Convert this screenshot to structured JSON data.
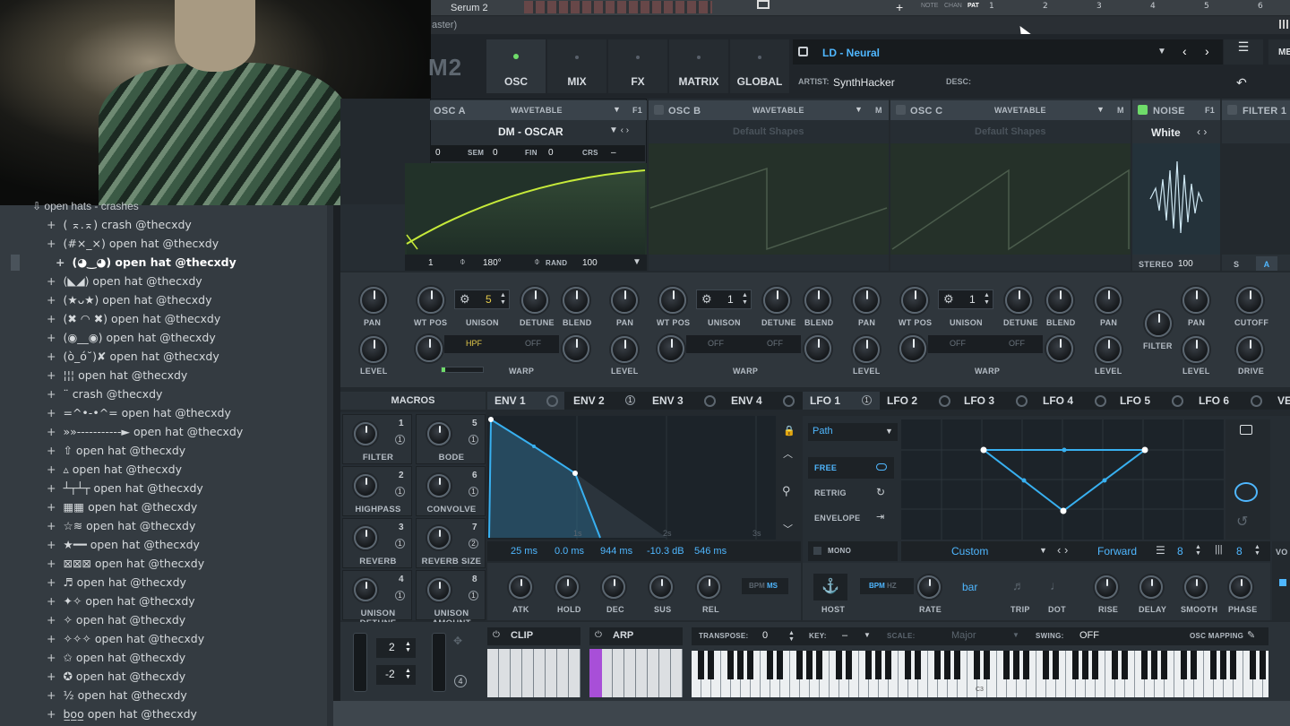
{
  "host_bar": {
    "plugin_title": "Serum 2",
    "window_hint": "aster)",
    "note": "NOTE",
    "chan": "CHAN",
    "pat": "PAT",
    "timeline": [
      "1",
      "2",
      "3",
      "4",
      "5",
      "6"
    ]
  },
  "browser": {
    "folder": "open hats - crashes",
    "items": [
      "( ⌅.⌅) crash @thecxdy",
      "(#×_×) open hat @thecxdy",
      "(◕‿◕) open hat @thecxdy",
      "(◣◢) open hat @thecxdy",
      "(★ᴗ★) open hat @thecxdy",
      "(✖ ◠ ✖) open hat @thecxdy",
      "(◉__◉) open hat @thecxdy",
      "(ò_ó˘)✘ open hat @thecxdy",
      "¦¦¦ open hat @thecxdy",
      "¨ crash @thecxdy",
      "=^•-•^= open hat @thecxdy",
      "»»-----------► open hat @thecxdy",
      "⇧ open hat @thecxdy",
      "▵ open hat @thecxdy",
      "┴┬┴┬ open hat @thecxdy",
      "▦▦ open hat @thecxdy",
      "☆≋ open hat @thecxdy",
      "★━━ open hat @thecxdy",
      "⊠⊠⊠ open hat @thecxdy",
      "♬ open hat @thecxdy",
      "✦✧ open hat @thecxdy",
      "✧ open hat @thecxdy",
      "✧✧✧ open hat @thecxdy",
      "✩ open hat @thecxdy",
      "✪ open hat @thecxdy",
      "½ open hat @thecxdy",
      "b̲o̲o̲ open hat @thecxdy"
    ],
    "selected_index": 2
  },
  "serum": {
    "logo": "M2",
    "tabs": [
      "OSC",
      "MIX",
      "FX",
      "MATRIX",
      "GLOBAL"
    ],
    "active_tab": "OSC",
    "preset_name": "LD - Neural",
    "artist_label": "ARTIST:",
    "artist": "SynthHacker",
    "desc_label": "DESC:",
    "menu_label": "ME"
  },
  "osc_a": {
    "name": "OSC A",
    "type": "WAVETABLE",
    "f": "F1",
    "table": "DM - OSCAR",
    "oct": "0",
    "sem_label": "SEM",
    "sem": "0",
    "fin_label": "FIN",
    "fin": "0",
    "crs_label": "CRS",
    "crs": "–",
    "phase_num": "1",
    "phase": "180°",
    "rand_label": "RAND",
    "rand": "100",
    "unison": "5",
    "warp_mode": "HPF",
    "warp_mode2": "OFF",
    "warp_label": "WARP"
  },
  "osc_b": {
    "name": "OSC B",
    "type": "WAVETABLE",
    "table": "Default Shapes",
    "m": "M",
    "unison": "1",
    "warp_mode": "OFF",
    "warp_mode2": "OFF",
    "warp_label": "WARP"
  },
  "osc_c": {
    "name": "OSC C",
    "type": "WAVETABLE",
    "table": "Default Shapes",
    "m": "M",
    "unison": "1",
    "warp_mode": "OFF",
    "warp_mode2": "OFF",
    "warp_label": "WARP"
  },
  "noise": {
    "name": "NOISE",
    "f": "F1",
    "type": "White",
    "stereo_label": "STEREO",
    "stereo": "100",
    "filter": "FILTER",
    "pan": "PAN",
    "level": "LEVEL"
  },
  "filter1": {
    "name": "FILTER 1",
    "s": "S",
    "a": "A",
    "cutoff": "CUTOFF",
    "drive": "DRIVE"
  },
  "knob_labels": {
    "pan": "PAN",
    "level": "LEVEL",
    "wtpos": "WT POS",
    "unison": "UNISON",
    "detune": "DETUNE",
    "blend": "BLEND"
  },
  "macros": {
    "title": "MACROS",
    "items": [
      {
        "name": "FILTER",
        "num": "1",
        "mod": "1"
      },
      {
        "name": "BODE",
        "num": "5",
        "mod": "1"
      },
      {
        "name": "HIGHPASS",
        "num": "2",
        "mod": "1"
      },
      {
        "name": "CONVOLVE",
        "num": "6",
        "mod": "1"
      },
      {
        "name": "REVERB",
        "num": "3",
        "mod": "1"
      },
      {
        "name": "REVERB SIZE",
        "num": "7",
        "mod": "2"
      },
      {
        "name": "UNISON DETUNE",
        "num": "4",
        "mod": "1"
      },
      {
        "name": "UNISON AMOUNT",
        "num": "8",
        "mod": "1"
      }
    ]
  },
  "mod_tabs": [
    {
      "label": "ENV 1",
      "badge": ""
    },
    {
      "label": "ENV 2",
      "badge": "1"
    },
    {
      "label": "ENV 3",
      "badge": ""
    },
    {
      "label": "ENV 4",
      "badge": ""
    },
    {
      "label": "LFO 1",
      "badge": "1"
    },
    {
      "label": "LFO 2",
      "badge": ""
    },
    {
      "label": "LFO 3",
      "badge": ""
    },
    {
      "label": "LFO 4",
      "badge": ""
    },
    {
      "label": "LFO 5",
      "badge": ""
    },
    {
      "label": "LFO 6",
      "badge": ""
    },
    {
      "label": "VEL",
      "badge": ""
    }
  ],
  "env": {
    "values": [
      "25 ms",
      "0.0 ms",
      "944 ms",
      "-10.3 dB",
      "546 ms"
    ],
    "knobs": [
      "ATK",
      "HOLD",
      "DEC",
      "SUS",
      "REL"
    ],
    "bpm": "BPM",
    "ms": "MS",
    "ticks": [
      "1s",
      "2s",
      "3s"
    ]
  },
  "lfo": {
    "mode_select": "Path",
    "modes": [
      "FREE",
      "RETRIG",
      "ENVELOPE"
    ],
    "mono": "MONO",
    "shape": "Custom",
    "direction": "Forward",
    "grid1": "8",
    "grid2": "8",
    "host": "HOST",
    "bpm": "BPM",
    "hz": "HZ",
    "rate_value": "bar",
    "knobs": [
      "RATE",
      "TRIP",
      "DOT",
      "RISE",
      "DELAY",
      "SMOOTH",
      "PHASE"
    ],
    "vo": "VO"
  },
  "bottom": {
    "val1": "2",
    "val2": "-2",
    "val3": "4",
    "clip": "CLIP",
    "arp": "ARP",
    "transpose_label": "TRANSPOSE:",
    "transpose": "0",
    "key_label": "KEY:",
    "key": "–",
    "scale_label": "SCALE:",
    "scale": "Major",
    "swing_label": "SWING:",
    "swing": "OFF",
    "osc_mapping": "OSC MAPPING",
    "c3": "C3"
  }
}
